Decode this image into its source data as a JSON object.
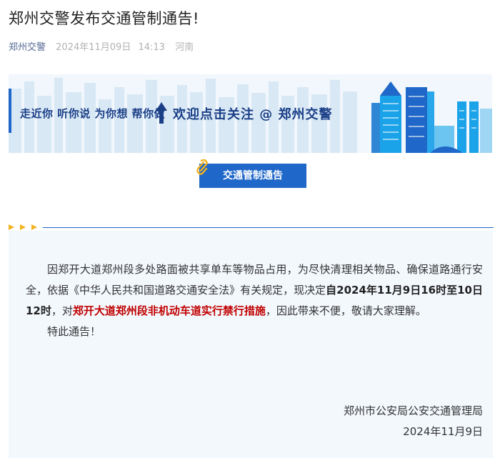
{
  "article": {
    "title": "郑州交警发布交通管制通告!",
    "account": "郑州交警",
    "date": "2024年11月09日",
    "time": "14:13",
    "location": "河南"
  },
  "banner": {
    "slogan": "走近你 听你说 为你想 帮你做",
    "welcome": "欢迎点击关注 @ 郑州交警"
  },
  "section": {
    "title": "交通管制通告"
  },
  "notice": {
    "p1_a": "因郑开大道郑州段多处路面被共享单车等物品占用，为尽快清理相关物品、确保道路通行安全，依据《中华人民共和国道路交通安全法》有关规定，现决定",
    "p1_bold": "自2024年11月9日16时至10日12时",
    "p1_b": "，对",
    "p1_red": "郑开大道郑州段非机动车道实行禁行措施",
    "p1_c": "，因此带来不便，敬请大家理解。",
    "p2": "特此通告！",
    "signature_org": "郑州市公安局公安交通管理局",
    "signature_date": "2024年11月9日"
  },
  "colors": {
    "accent_blue": "#1f67c8",
    "banner_text": "#1a3f87",
    "highlight_red": "#c00000",
    "decor_yellow": "#f2b21f",
    "notice_bg": "#f3f8fd",
    "meta_gray": "#b2b2b2",
    "account_link": "#576b95"
  },
  "icons": [
    "up-arrow-icon",
    "paperclip-icon",
    "triangle-marker-icon"
  ]
}
